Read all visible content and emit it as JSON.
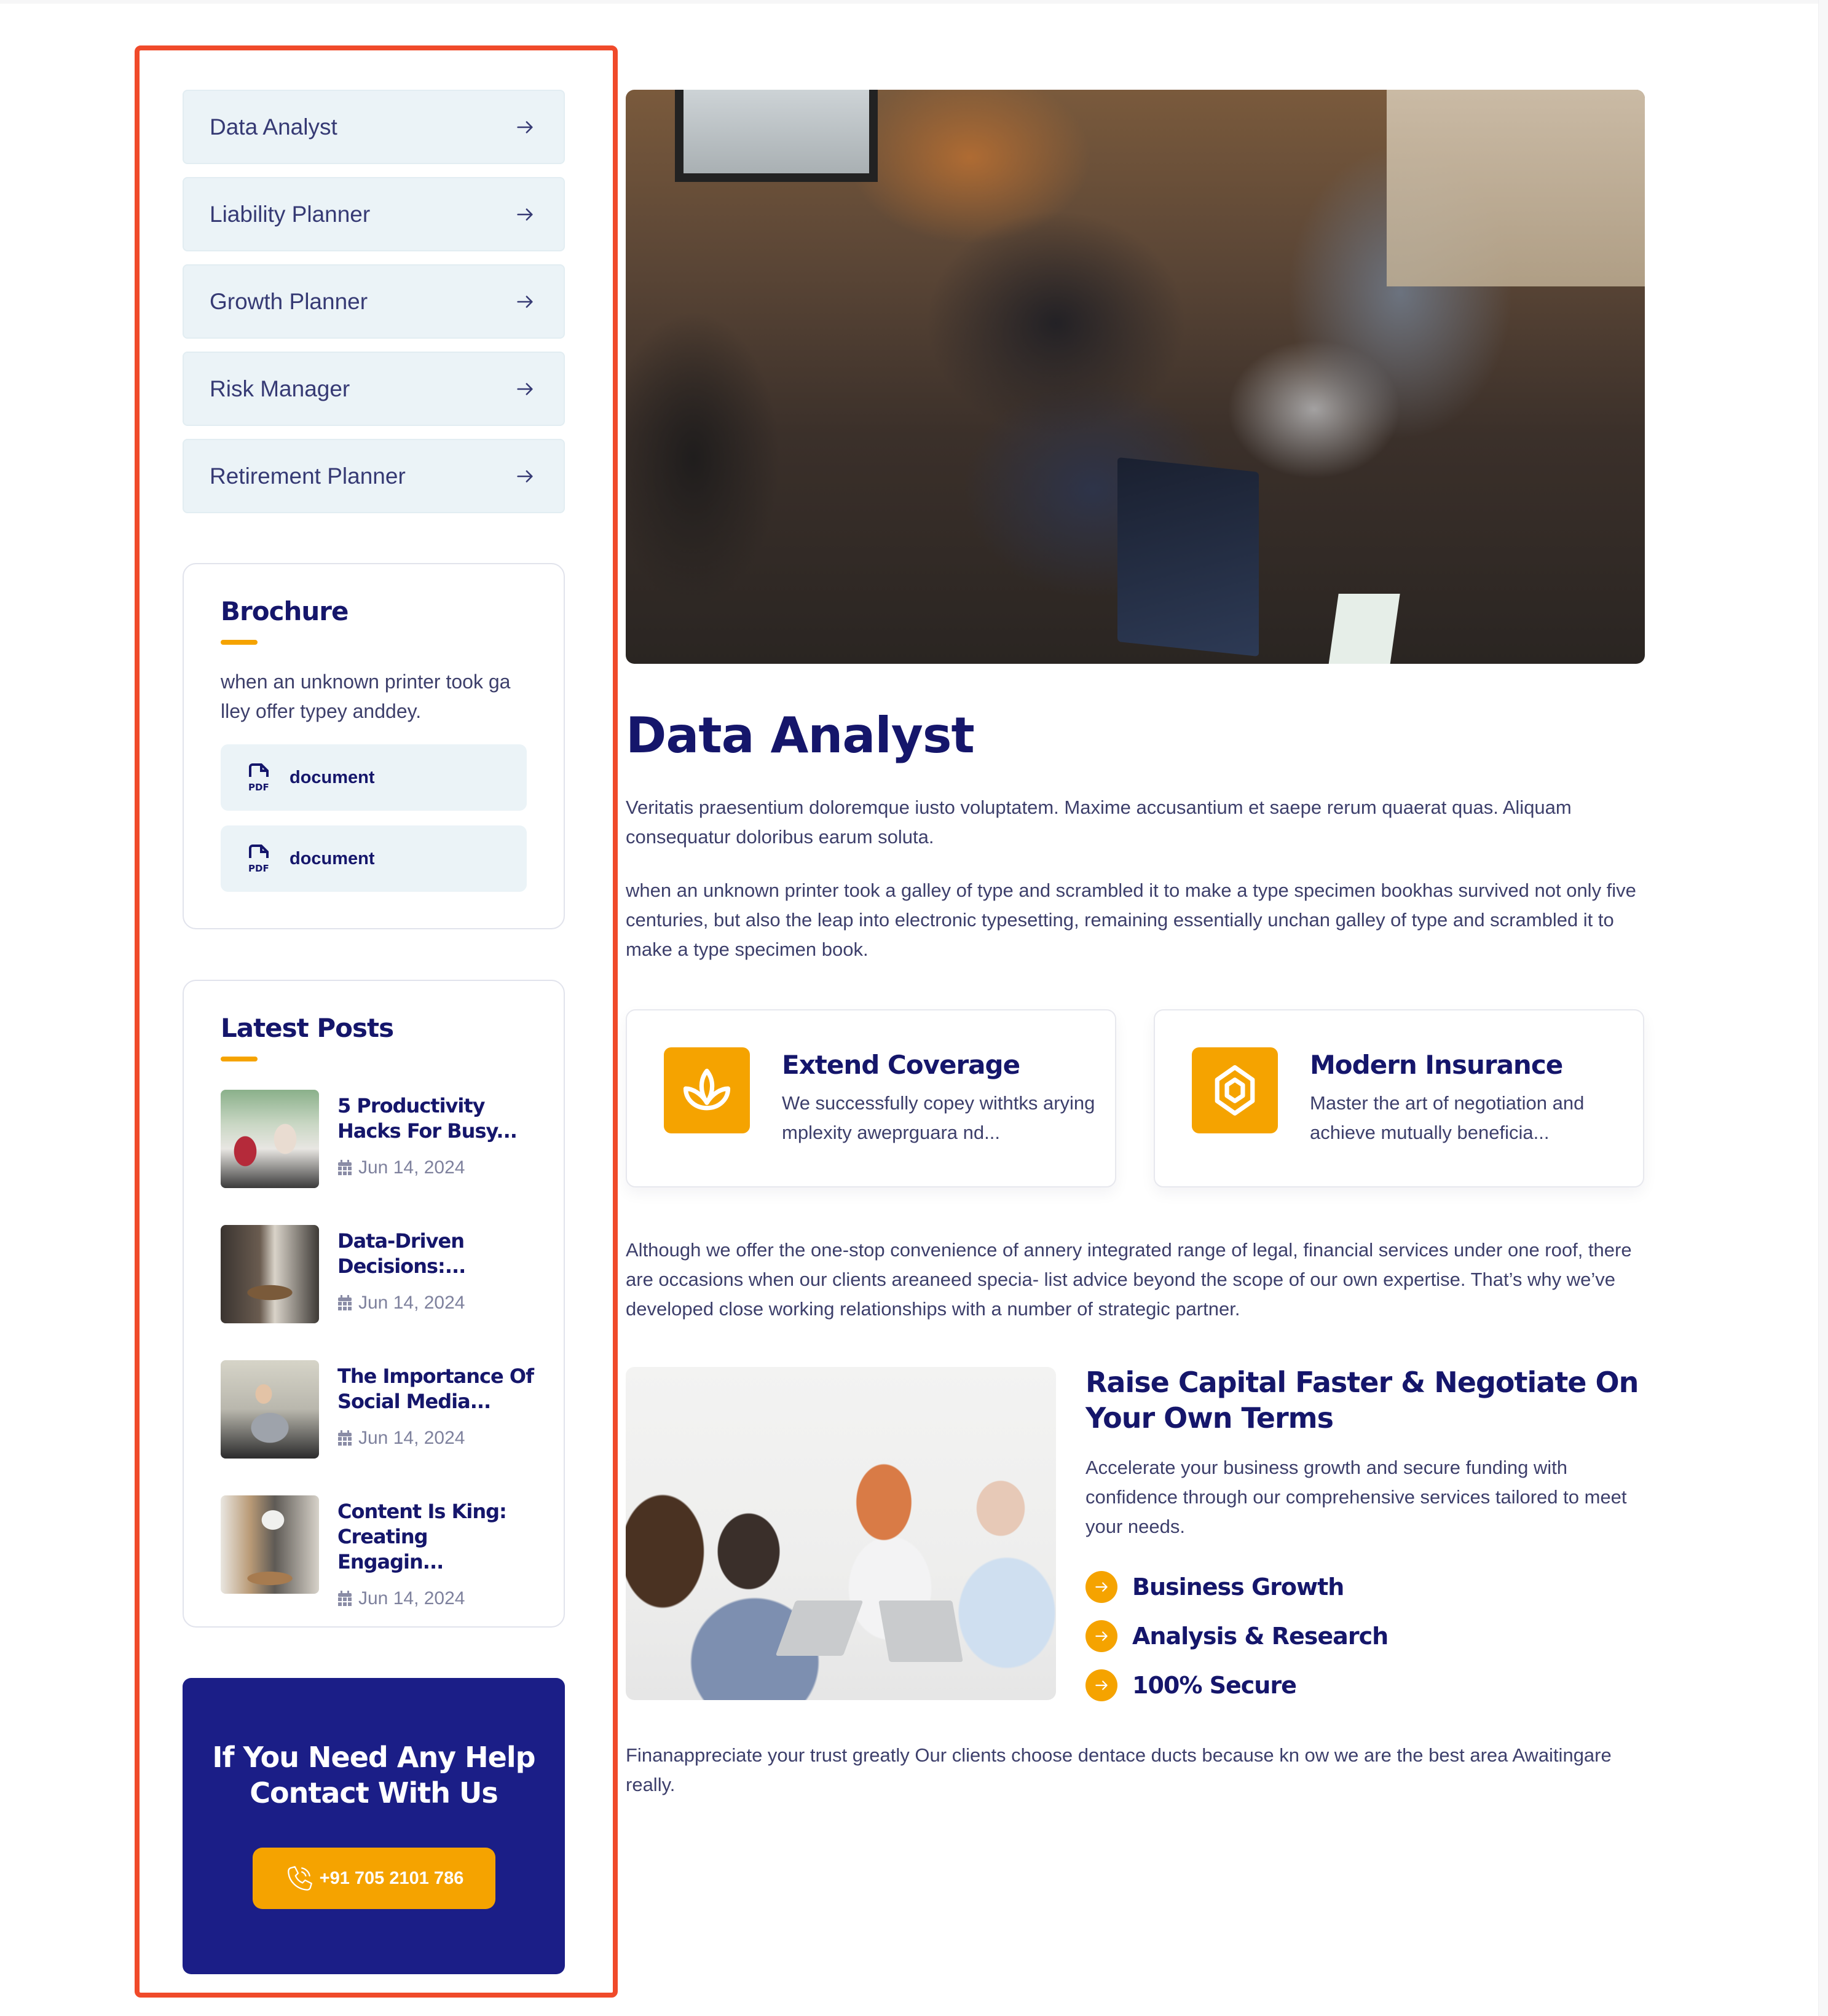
{
  "sidebar": {
    "nav_items": [
      {
        "label": "Data Analyst",
        "icon": "arrow-right-icon"
      },
      {
        "label": "Liability Planner",
        "icon": "arrow-right-icon"
      },
      {
        "label": "Growth Planner",
        "icon": "arrow-right-icon"
      },
      {
        "label": "Risk Manager",
        "icon": "arrow-right-icon"
      },
      {
        "label": "Retirement Planner",
        "icon": "arrow-right-icon"
      }
    ],
    "brochure": {
      "title": "Brochure",
      "text": "when an unknown printer took ga lley offer typey anddey.",
      "documents": [
        {
          "label": "document",
          "icon": "pdf-icon"
        },
        {
          "label": "document",
          "icon": "pdf-icon"
        }
      ]
    },
    "latest_posts": {
      "title": "Latest Posts",
      "posts": [
        {
          "title": "5 Productivity Hacks For Busy...",
          "date": "Jun 14, 2024"
        },
        {
          "title": "Data-Driven Decisions:...",
          "date": "Jun 14, 2024"
        },
        {
          "title": "The Importance Of Social Media...",
          "date": "Jun 14, 2024"
        },
        {
          "title": "Content Is King: Creating Engagin...",
          "date": "Jun 14, 2024"
        }
      ]
    },
    "contact": {
      "title": "If You Need Any Help Contact With Us",
      "phone": "+91 705 2101 786"
    }
  },
  "main": {
    "title": "Data Analyst",
    "paragraph_1": "Veritatis praesentium doloremque iusto voluptatem. Maxime accusantium et saepe rerum quaerat quas. Aliquam consequatur doloribus earum soluta.",
    "paragraph_2": "when an unknown printer took a galley of type and scrambled it to make a type specimen bookhas survived not only five centuries, but also the leap into electronic typesetting, remaining essentially unchan galley of type and scrambled it to make a type specimen book.",
    "features": [
      {
        "title": "Extend Coverage",
        "text": "We successfully copey withtks arying mplexity aweprguara nd...",
        "icon": "lotus-icon"
      },
      {
        "title": "Modern Insurance",
        "text": "Master the art of negotiation and achieve mutually beneficia...",
        "icon": "hexagon-icon"
      }
    ],
    "paragraph_3": "Although we offer the one-stop convenience of annery integrated range of legal, financial services under one roof, there are occasions when our clients areaneed specia- list advice beyond the scope of our own expertise. That’s why we’ve developed close working relationships with a number of strategic partner.",
    "raise": {
      "title": "Raise Capital Faster & Negotiate On Your Own Terms",
      "text": "Accelerate your business growth and secure funding with confidence through our comprehensive services tailored to meet your needs.",
      "checklist": [
        "Business Growth",
        "Analysis & Research",
        "100% Secure"
      ]
    },
    "paragraph_4": "Finanappreciate your trust greatly Our clients choose dentace ducts because kn ow we are the best area Awaitingare really."
  },
  "colors": {
    "accent": "#f5a300",
    "navy": "#15166b",
    "contact_bg": "#1b1e87",
    "nav_bg": "#ebf3f7",
    "highlight_outline": "#f04a2a",
    "body_text": "#3d3f6b"
  }
}
